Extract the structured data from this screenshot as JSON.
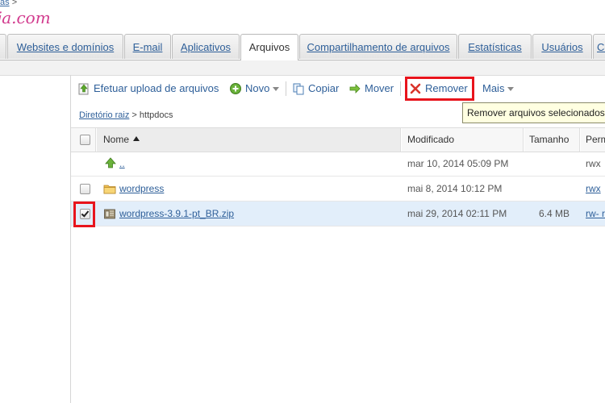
{
  "header": {
    "crumb_top": "as",
    "crumb_sep": ">",
    "brand": "ja.com"
  },
  "tabs": [
    {
      "label": "Websites e domínios"
    },
    {
      "label": "E-mail"
    },
    {
      "label": "Aplicativos"
    },
    {
      "label": "Arquivos",
      "active": true
    },
    {
      "label": "Compartilhamento de arquivos"
    },
    {
      "label": "Estatísticas"
    },
    {
      "label": "Usuários"
    },
    {
      "label": "Co"
    }
  ],
  "toolbar": {
    "upload": "Efetuar upload de arquivos",
    "new": "Novo",
    "copy": "Copiar",
    "move": "Mover",
    "remove": "Remover",
    "more": "Mais"
  },
  "tooltip": "Remover arquivos selecionados",
  "path": {
    "root": "Diretório raiz",
    "sep": ">",
    "current": "httpdocs"
  },
  "table": {
    "columns": {
      "name": "Nome",
      "modified": "Modificado",
      "size": "Tamanho",
      "perm": "Perm"
    },
    "rows": [
      {
        "name": "..",
        "modified": "mar 10, 2014 05:09 PM",
        "size": "",
        "perm": "rwx",
        "type": "parent",
        "checked": false,
        "has_checkbox": false
      },
      {
        "name": "wordpress",
        "modified": "mai 8, 2014 10:12 PM",
        "size": "",
        "perm": "rwx",
        "type": "folder",
        "checked": false,
        "has_checkbox": true
      },
      {
        "name": "wordpress-3.9.1-pt_BR.zip",
        "modified": "mai 29, 2014 02:11 PM",
        "size": "6.4 MB",
        "perm": "rw- r",
        "type": "archive",
        "checked": true,
        "has_checkbox": true
      }
    ]
  },
  "colors": {
    "link": "#2e5f99",
    "highlight_box": "#e8141c",
    "selected_row": "#e2eefa",
    "tooltip_bg": "#ffffe1",
    "brand": "#d23b8e"
  }
}
